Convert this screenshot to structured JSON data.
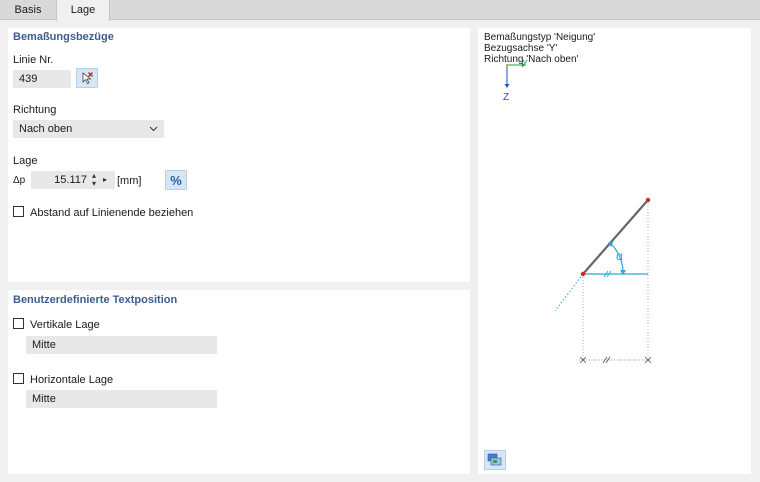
{
  "tabs": [
    {
      "label": "Basis",
      "active": false
    },
    {
      "label": "Lage",
      "active": true
    }
  ],
  "section_refs": {
    "title": "Bemaßungsbezüge",
    "line_label": "Linie Nr.",
    "line_value": "439",
    "direction_label": "Richtung",
    "direction_value": "Nach oben",
    "position_label": "Lage",
    "delta_symbol": "Δp",
    "position_value": "15.117",
    "position_unit": "[mm]",
    "percent_label": "%",
    "end_distance_label": "Abstand auf Linienende beziehen",
    "end_distance_checked": false
  },
  "section_textpos": {
    "title": "Benutzerdefinierte Textposition",
    "vertical_label": "Vertikale Lage",
    "vertical_checked": false,
    "vertical_value": "Mitte",
    "horizontal_label": "Horizontale Lage",
    "horizontal_checked": false,
    "horizontal_value": "Mitte"
  },
  "preview": {
    "line1": "Bemaßungstyp 'Neigung'",
    "line2": "Bezugsachse 'Y'",
    "line3": "Richtung 'Nach oben'",
    "axis_y": "Y",
    "axis_z": "Z",
    "angle_symbol": "α"
  },
  "icons": {
    "pick_line": "cursor-pick-icon",
    "preview_toggle": "display-settings-icon"
  },
  "colors": {
    "section_title": "#3b5d8f",
    "accent_cyan": "#2aa8d8",
    "point_red": "#cc2a1a",
    "axis_blue": "#1b55c4",
    "axis_green": "#20a040"
  }
}
